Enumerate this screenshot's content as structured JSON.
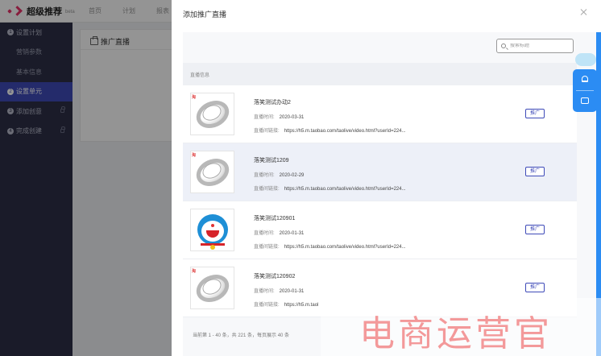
{
  "app": {
    "logo_text": "超级推荐",
    "logo_beta": "beta",
    "nav": [
      "首页",
      "计划",
      "报表"
    ]
  },
  "sidebar": {
    "items": [
      {
        "num": "1",
        "label": "设置计划",
        "type": "step"
      },
      {
        "label": "营销参数",
        "type": "sub"
      },
      {
        "label": "基本信息",
        "type": "sub"
      },
      {
        "num": "2",
        "label": "设置单元",
        "type": "step",
        "active": true
      },
      {
        "num": "3",
        "label": "添加创意",
        "type": "step",
        "locked": true
      },
      {
        "num": "4",
        "label": "完成创建",
        "type": "step",
        "locked": true
      }
    ]
  },
  "background_panel": {
    "title": "推广直播"
  },
  "modal": {
    "title": "添加推广直播",
    "search_placeholder": "搜索标题",
    "list_header": "直播信息",
    "time_label": "直播时间:",
    "link_label": "直播间链接:",
    "promote_label": "推广",
    "footer": "当前第 1 - 40 条，共 221 条，每页展示 40 条",
    "rows": [
      {
        "title": "落笑测试办动2",
        "time": "2020-03-31",
        "link": "https://h5.m.taobao.com/taolive/video.html?userId=224...",
        "thumb": "ring",
        "highlight": false
      },
      {
        "title": "落笑测试1209",
        "time": "2020-02-29",
        "link": "https://h5.m.taobao.com/taolive/video.html?userId=224...",
        "thumb": "ring",
        "highlight": true
      },
      {
        "title": "落笑测试120901",
        "time": "2020-01-31",
        "link": "https://h5.m.taobao.com/taolive/video.html?userId=224...",
        "thumb": "doraemon",
        "highlight": false
      },
      {
        "title": "落笑测试120902",
        "time": "2020-01-31",
        "link": "https://h5.m.taol",
        "thumb": "ring",
        "highlight": false
      }
    ]
  },
  "watermark": "电商运营官"
}
